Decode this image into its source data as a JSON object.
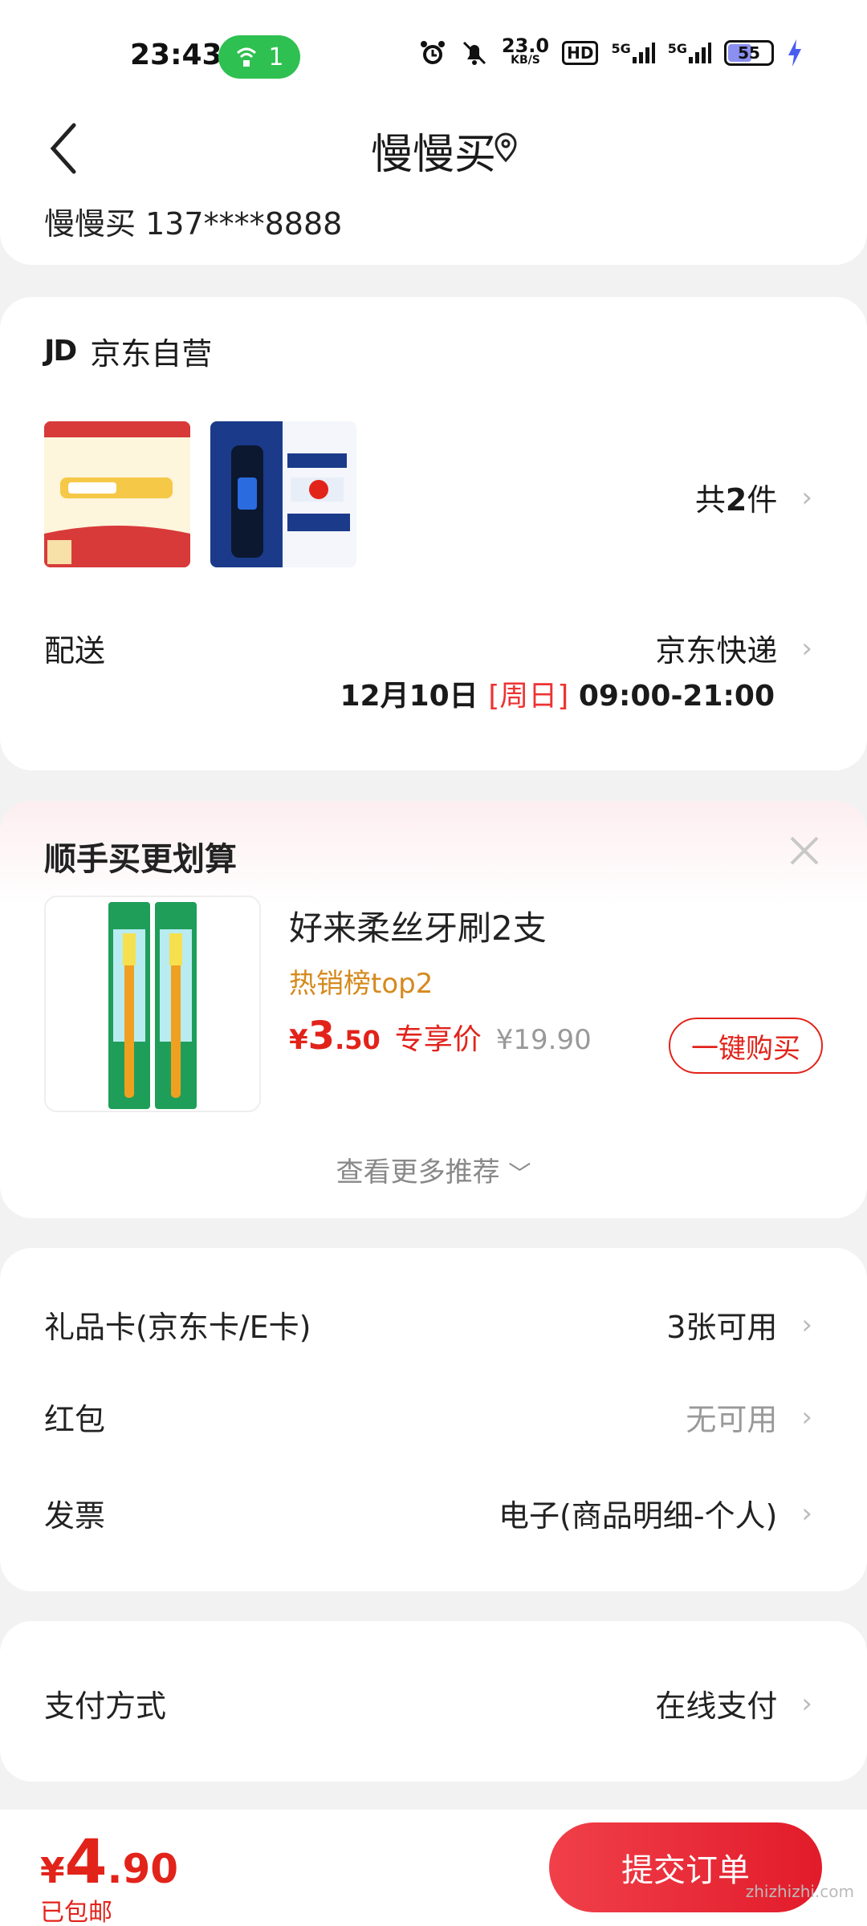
{
  "status_bar": {
    "time": "23:43",
    "hotspot_count": "1",
    "net_speed": "23.0",
    "net_unit": "KB/S",
    "hd": "HD",
    "sig1": "5G",
    "sig2": "5G",
    "battery": "55"
  },
  "header": {
    "title": "慢慢买",
    "address": "慢慢买  137****8888"
  },
  "order": {
    "store": "京东自营",
    "store_logo": "JD",
    "count_prefix": "共",
    "count": "2",
    "count_suffix": "件",
    "delivery_label": "配送",
    "delivery_method": "京东快递",
    "delivery_date": "12月10日",
    "delivery_weekday": "[周日]",
    "delivery_window": "09:00-21:00"
  },
  "recommend": {
    "title": "顺手买更划算",
    "product_name": "好来柔丝牙刷2支",
    "tag": "热销榜top2",
    "price_symbol": "¥",
    "price_int": "3",
    "price_dec": ".50",
    "exclusive_label": "专享价",
    "original_price": "¥19.90",
    "buy_label": "一键购买",
    "more_label": "查看更多推荐"
  },
  "benefits": {
    "giftcard_label": "礼品卡(京东卡/E卡)",
    "giftcard_value": "3张可用",
    "redpacket_label": "红包",
    "redpacket_value": "无可用",
    "invoice_label": "发票",
    "invoice_value": "电子(商品明细-个人)"
  },
  "payment": {
    "label": "支付方式",
    "value": "在线支付"
  },
  "footer": {
    "currency": "¥",
    "total_int": "4",
    "total_dec": ".90",
    "shipping_note": "已包邮",
    "submit_label": "提交订单",
    "watermark": "zhizhizhi.com"
  },
  "colors": {
    "accent": "#e2231a",
    "tag": "#d58a1e",
    "hotspot": "#2ec050"
  }
}
